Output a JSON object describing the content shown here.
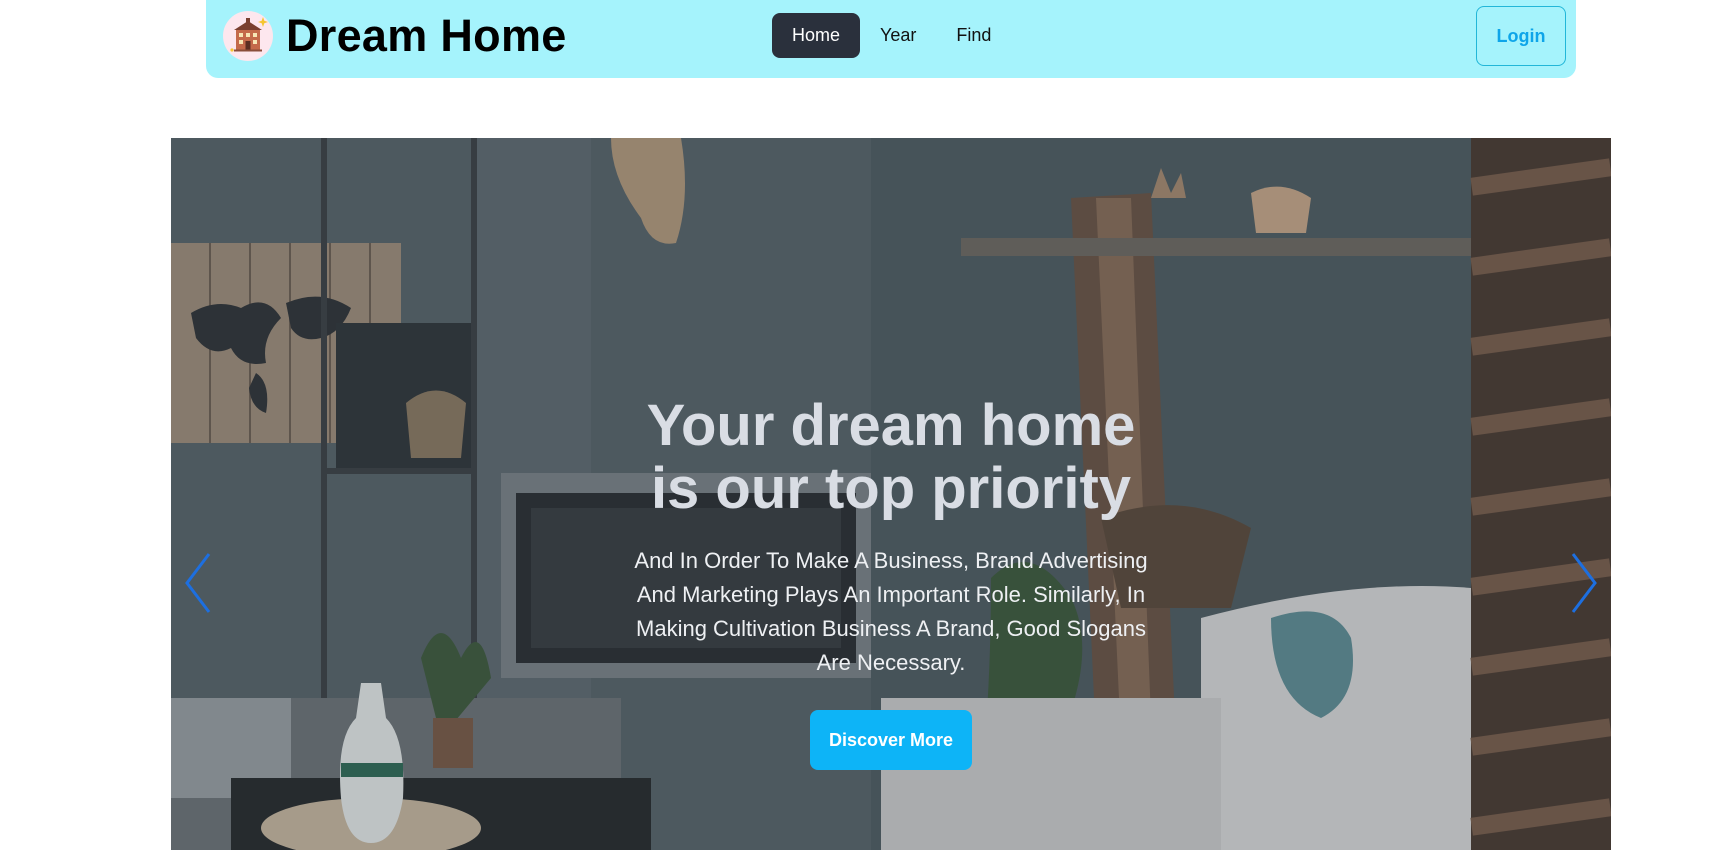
{
  "navbar": {
    "brand": "Dream Home",
    "logo_icon": "house-building-icon",
    "links": [
      {
        "label": "Home",
        "active": true
      },
      {
        "label": "Year",
        "active": false
      },
      {
        "label": "Find",
        "active": false
      }
    ],
    "login_label": "Login"
  },
  "hero": {
    "title_line1": "Your dream home",
    "title_line2": "is our top priority",
    "text": "And In Order To Make A Business, Brand Advertising And Marketing Plays An Important Role. Similarly, In Making Cultivation Business A Brand, Good Slogans Are Necessary.",
    "cta_label": "Discover More",
    "prev_icon": "chevron-left-icon",
    "next_icon": "chevron-right-icon"
  },
  "colors": {
    "navbar_bg": "#a5f3fc",
    "active_link_bg": "#2a303c",
    "accent": "#0db4f7",
    "arrow": "#1d6fe0"
  }
}
